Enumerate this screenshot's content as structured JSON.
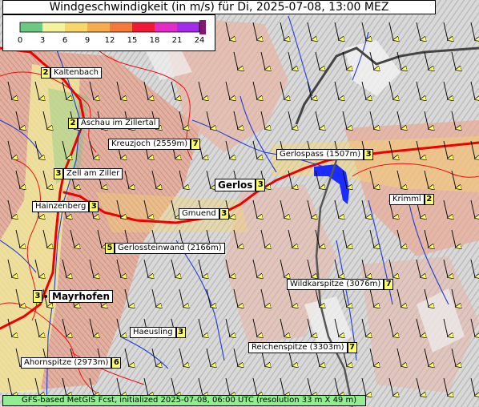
{
  "title": "Windgeschwindigkeit (in m/s) für Di, 2025-07-08, 13:00 MEZ",
  "legend": {
    "ticks": [
      "0",
      "3",
      "6",
      "9",
      "12",
      "15",
      "18",
      "21",
      "24"
    ],
    "colors": [
      "#6dc882",
      "#f4f39b",
      "#f8d768",
      "#f5ad4f",
      "#f47a3b",
      "#f11a34",
      "#e22cc5",
      "#a52bec",
      "#7f1a6c"
    ]
  },
  "footer": "GFS-based MetGIS Fcst, initialized 2025-07-08, 06:00 UTC  (resolution 33 m X 49 m)",
  "places": [
    {
      "name": "Kaltenbach",
      "value": "2"
    },
    {
      "name": "Aschau im Zillertal",
      "value": "2"
    },
    {
      "name": "Kreuzjoch (2559m)",
      "value": "7"
    },
    {
      "name": "Zell am Ziller",
      "value": "3"
    },
    {
      "name": "Gerlos",
      "value": "3"
    },
    {
      "name": "Gerlospass (1507m)",
      "value": "3"
    },
    {
      "name": "Hainzenberg",
      "value": "3"
    },
    {
      "name": "Gmuend",
      "value": "3"
    },
    {
      "name": "Krimml",
      "value": "2"
    },
    {
      "name": "Gerlossteinwand (2166m)",
      "value": "5"
    },
    {
      "name": "Wildkarspitze (3076m)",
      "value": "7"
    },
    {
      "name": "Mayrhofen",
      "value": "3"
    },
    {
      "name": "Haeusling",
      "value": "3"
    },
    {
      "name": "Reichenspitze (3303m)",
      "value": "7"
    },
    {
      "name": "Ahornspitze (2973m)",
      "value": "6"
    }
  ]
}
